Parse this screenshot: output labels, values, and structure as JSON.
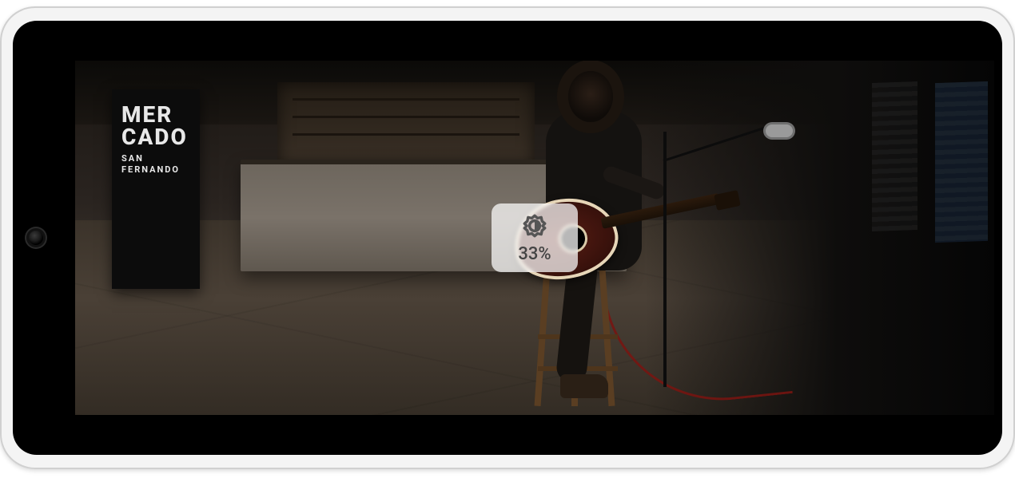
{
  "overlay": {
    "brightness_percent": "33%",
    "icon": "brightness-icon"
  },
  "scene": {
    "banner_line1": "MER",
    "banner_line2": "CADO",
    "banner_sub": "SAN FERNANDO"
  }
}
